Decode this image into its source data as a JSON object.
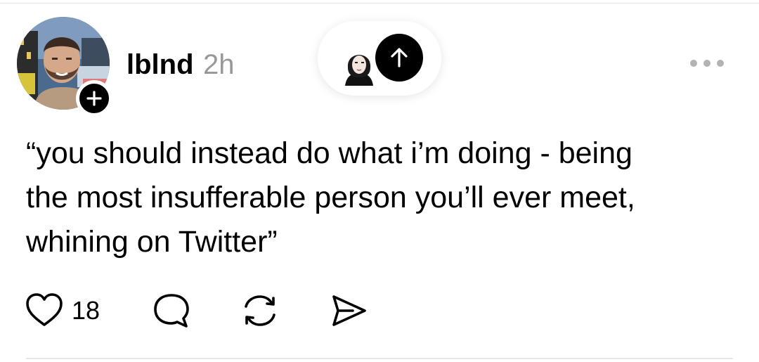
{
  "post": {
    "author": {
      "username": "lblnd",
      "timestamp": "2h"
    },
    "text_lines": [
      "“you should instead do what i’m doing - being",
      "the most insufferable person you’ll ever meet,",
      "whining on Twitter”"
    ],
    "actions": {
      "like_count": "18",
      "like_icon": "heart-icon",
      "reply_icon": "speech-bubble-icon",
      "repost_icon": "repost-icon",
      "share_icon": "send-icon"
    }
  },
  "header": {
    "more_icon": "ellipsis-icon",
    "scroll_to_top_icon": "arrow-up-icon",
    "follow_icon": "plus-icon"
  },
  "colors": {
    "text": "#000000",
    "muted": "#999999",
    "divider": "#e6e6e6",
    "dots": "#b3b3b3"
  }
}
